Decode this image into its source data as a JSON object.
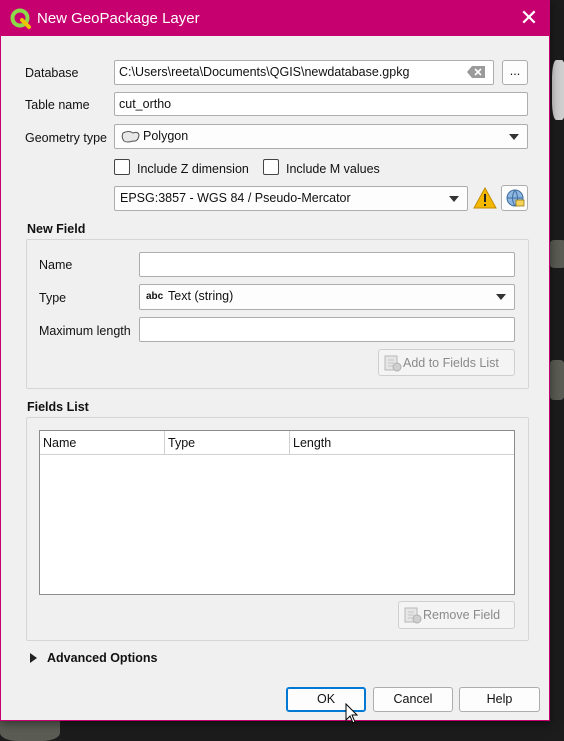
{
  "window": {
    "title": "New GeoPackage Layer",
    "close_glyph": "✕"
  },
  "form": {
    "database_label": "Database",
    "database_value": "C:\\Users\\reeta\\Documents\\QGIS\\newdatabase.gpkg",
    "browse_label": "...",
    "table_name_label": "Table name",
    "table_name_value": "cut_ortho",
    "geometry_type_label": "Geometry type",
    "geometry_type_value": "Polygon",
    "include_z_label": "Include Z dimension",
    "include_m_label": "Include M values",
    "crs_value": "EPSG:3857 - WGS 84 / Pseudo-Mercator"
  },
  "new_field": {
    "title": "New Field",
    "name_label": "Name",
    "name_value": "",
    "type_label": "Type",
    "type_prefix": "abc",
    "type_value": "Text (string)",
    "max_length_label": "Maximum length",
    "max_length_value": "",
    "add_button": "Add to Fields List"
  },
  "fields_list": {
    "title": "Fields List",
    "columns": [
      "Name",
      "Type",
      "Length"
    ],
    "rows": [],
    "remove_button": "Remove Field"
  },
  "advanced": {
    "label": "Advanced Options"
  },
  "buttons": {
    "ok": "OK",
    "cancel": "Cancel",
    "help": "Help"
  },
  "colors": {
    "titlebar": "#c6006f",
    "ok_border": "#0078d4",
    "warning": "#f5b800"
  }
}
